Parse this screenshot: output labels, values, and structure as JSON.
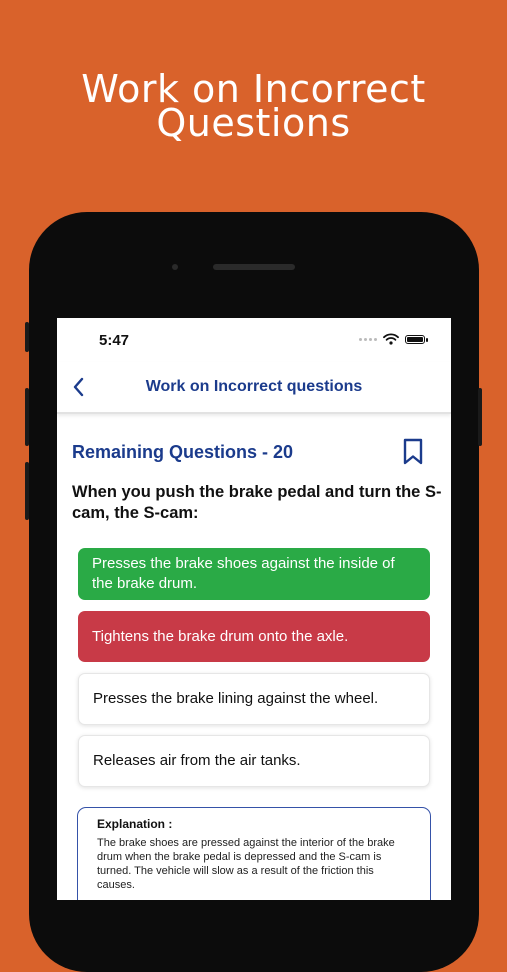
{
  "promo": {
    "title_line1": "Work on Incorrect",
    "title_line2": "Questions"
  },
  "status_bar": {
    "time": "5:47"
  },
  "nav": {
    "title": "Work on Incorrect questions"
  },
  "quiz": {
    "remaining": "Remaining Questions - 20",
    "question_line1": "When you push the brake pedal and turn the S-",
    "question_line2": "cam, the S-cam:",
    "options": [
      {
        "text": "Presses the brake shoes against the inside of the brake drum.",
        "state": "correct"
      },
      {
        "text": "Tightens the brake drum onto the axle.",
        "state": "incorrect"
      },
      {
        "text": "Presses the brake lining against the wheel.",
        "state": "neutral"
      },
      {
        "text": "Releases air from the air tanks.",
        "state": "neutral"
      }
    ],
    "explanation_title": "Explanation :",
    "explanation_body": "The brake shoes are pressed against the interior of the brake drum when the brake pedal is depressed and the S-cam is turned. The vehicle will slow as a result of the friction this causes."
  },
  "colors": {
    "background": "#D9622B",
    "accent": "#1b3b8c",
    "correct": "#2aaa46",
    "incorrect": "#c83a47"
  },
  "icons": {
    "back": "chevron-left-icon",
    "bookmark": "bookmark-icon",
    "wifi": "wifi-icon",
    "battery": "battery-icon"
  }
}
